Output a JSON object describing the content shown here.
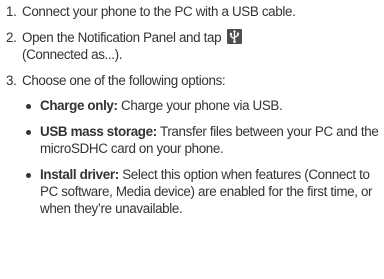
{
  "steps": [
    {
      "number": "1.",
      "text": "Connect your phone to the PC with a USB cable."
    },
    {
      "number": "2.",
      "text_before": "Open the Notification Panel and tap",
      "icon": "usb-icon",
      "text_after": "(Connected as...)."
    },
    {
      "number": "3.",
      "text": "Choose one of the following options:",
      "options": [
        {
          "term": "Charge only:",
          "description": "Charge your phone via USB."
        },
        {
          "term": "USB mass storage:",
          "description": "Transfer files between your PC and the microSDHC card on your phone."
        },
        {
          "term": "Install driver:",
          "description": "Select this option when features (Connect to PC software, Media device) are enabled for the first time, or when they’re unavailable."
        }
      ]
    }
  ]
}
